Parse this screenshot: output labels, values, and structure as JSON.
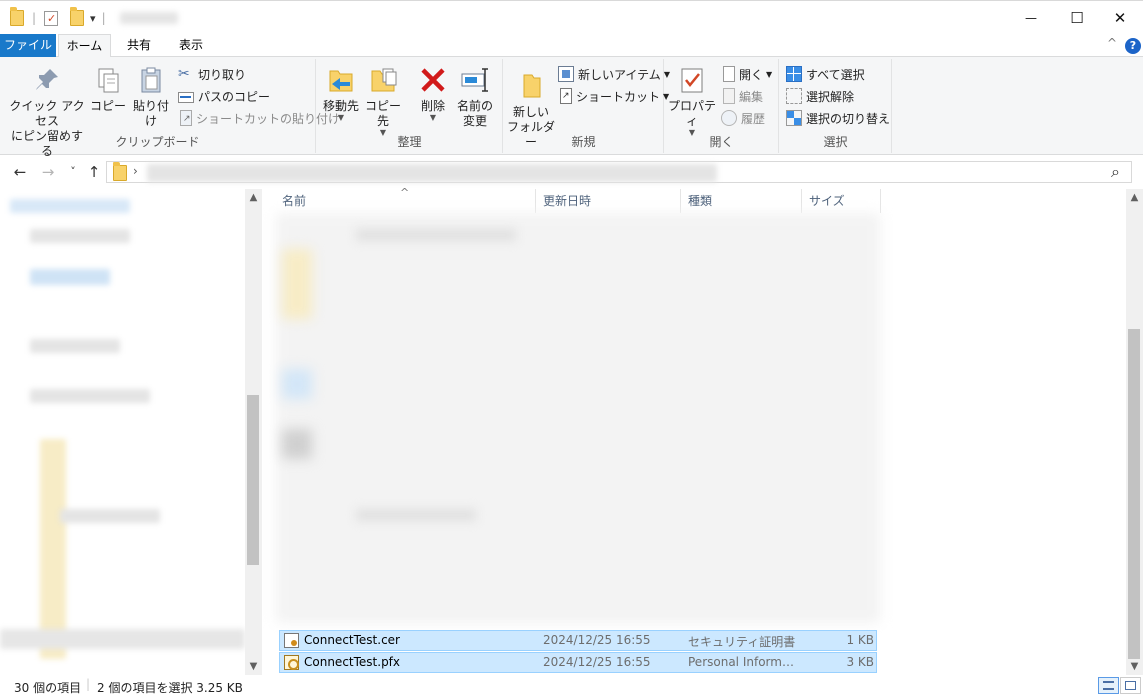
{
  "quick_access": {
    "separator": "|",
    "dropdown": "▾"
  },
  "window_controls": {
    "minimize": "—",
    "maximize": "☐",
    "close": "✕"
  },
  "tabs": {
    "file": "ファイル",
    "home": "ホーム",
    "share": "共有",
    "view": "表示",
    "help": "?",
    "collapse": "^"
  },
  "ribbon": {
    "clipboard": {
      "label": "クリップボード",
      "pin_line1": "クイック アクセス",
      "pin_line2": "にピン留めする",
      "copy": "コピー",
      "paste": "貼り付け",
      "cut": "切り取り",
      "copy_path": "パスのコピー",
      "paste_shortcut": "ショートカットの貼り付け"
    },
    "organize": {
      "label": "整理",
      "move_to": "移動先",
      "copy_to": "コピー先",
      "delete": "削除",
      "rename_line1": "名前の",
      "rename_line2": "変更"
    },
    "new": {
      "label": "新規",
      "new_folder_line1": "新しい",
      "new_folder_line2": "フォルダー",
      "new_item": "新しいアイテム",
      "shortcut": "ショートカット"
    },
    "open": {
      "label": "開く",
      "properties": "プロパティ",
      "open": "開く",
      "edit": "編集",
      "history": "履歴"
    },
    "select": {
      "label": "選択",
      "select_all": "すべて選択",
      "select_none": "選択解除",
      "invert": "選択の切り替え"
    }
  },
  "nav": {
    "back": "←",
    "forward": "→",
    "recent": "˅",
    "up": "↑",
    "crumb_sep": "›",
    "search_icon": "⌕"
  },
  "columns": {
    "name": "名前",
    "modified": "更新日時",
    "type": "種類",
    "size": "サイズ",
    "sort_indicator": "^"
  },
  "files": [
    {
      "name": "ConnectTest.cer",
      "modified": "2024/12/25 16:55",
      "type": "セキュリティ証明書",
      "size": "1 KB"
    },
    {
      "name": "ConnectTest.pfx",
      "modified": "2024/12/25 16:55",
      "type": "Personal Informati...",
      "size": "3 KB"
    }
  ],
  "status": {
    "item_count": "30 個の項目",
    "selection": "2 個の項目を選択  3.25 KB"
  },
  "scroll": {
    "up": "▲",
    "down": "▼"
  }
}
